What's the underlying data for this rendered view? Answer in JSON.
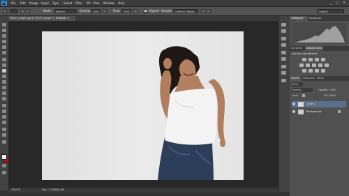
{
  "app": {
    "logo": "Ps"
  },
  "menu": [
    "File",
    "Edit",
    "Image",
    "Layer",
    "Type",
    "Select",
    "Filter",
    "3D",
    "View",
    "Window",
    "Help"
  ],
  "window_controls": [
    "_",
    "□",
    "×"
  ],
  "options_bar": {
    "mode_label": "Mode:",
    "mode_value": "Normal",
    "opacity_label": "Opacity:",
    "opacity_value": "100%",
    "flow_label": "Flow:",
    "flow_value": "100%",
    "aligned_label": "Aligned",
    "sample_label": "Sample:",
    "sample_value": "Current & Below",
    "workspace_value": "Default"
  },
  "document_tab": "BEX-3_begin.jpg @ 16.7% (Layer 1, RGB/8#) ×",
  "status": {
    "zoom": "16.67%",
    "doc_info": "Doc: 17.8M/35.6M"
  },
  "panels": {
    "top_tabs": [
      "Histogram",
      "Navigator"
    ],
    "adj_tabs": [
      "Libraries",
      "Adjustments"
    ],
    "adj_title": "Add an adjustment",
    "layer_tabs": [
      "Layers",
      "Channels",
      "Paths"
    ],
    "kind_label": "Kind",
    "blend_value": "Normal",
    "opacity_label": "Opacity: 100%",
    "lock_label": "Lock:",
    "fill_label": "Fill: 100%",
    "layers": [
      {
        "name": "Layer 1",
        "selected": true
      },
      {
        "name": "Background",
        "selected": false
      }
    ]
  },
  "colors": {
    "foreground": "#eeeeee",
    "background": "#c41212",
    "accent": "#31a8ff",
    "selected_layer": "#5a6f8a"
  },
  "icons": [
    "brush-icon",
    "clone-stamp-icon",
    "eye-icon",
    "lock-icon",
    "histogram-icon",
    "adjustments-icon"
  ]
}
